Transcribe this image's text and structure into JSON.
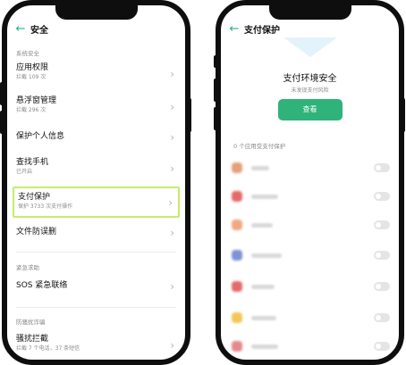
{
  "left_screen": {
    "title": "安全",
    "section_system": "系统安全",
    "items": [
      {
        "title": "应用权限",
        "sub": "拦截 109 次"
      },
      {
        "title": "悬浮窗管理",
        "sub": "拦截 296 次"
      },
      {
        "title": "保护个人信息",
        "sub": ""
      },
      {
        "title": "查找手机",
        "sub": "已开启"
      },
      {
        "title": "支付保护",
        "sub": "保护 3733 次支付操作"
      },
      {
        "title": "文件防误删",
        "sub": ""
      }
    ],
    "section_emergency": "紧急求助",
    "sos": {
      "title": "SOS 紧急联络"
    },
    "section_fraud": "防骚扰诈骗",
    "harass": {
      "title": "骚扰拦截",
      "sub": "拦截 7 个电话，37 条短信"
    }
  },
  "right_screen": {
    "title": "支付保护",
    "status_title": "支付环境安全",
    "status_sub": "未发现支付风险",
    "view_button": "查看",
    "apps_label": "0 个应用受支付保护",
    "apps": [
      {
        "color": "#e8a07a"
      },
      {
        "color": "#e46b6b"
      },
      {
        "color": "#f0a883"
      },
      {
        "color": "#7d93d6"
      },
      {
        "color": "#e46b6b"
      },
      {
        "color": "#f2c75a"
      },
      {
        "color": "#e58a8a"
      }
    ]
  },
  "colors": {
    "accent": "#2fb37a",
    "highlight": "#c7ec6a"
  }
}
